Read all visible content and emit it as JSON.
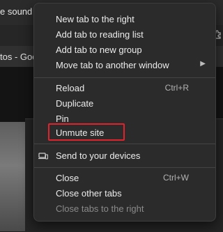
{
  "background": {
    "tab_top_title": "e sound o",
    "tab_top_close": "×",
    "extension_icon": "puzzle-icon",
    "tab_second_title": "tos - Goo"
  },
  "context_menu": {
    "items": [
      {
        "label": "New tab to the right"
      },
      {
        "label": "Add tab to reading list"
      },
      {
        "label": "Add tab to new group"
      },
      {
        "label": "Move tab to another window",
        "has_submenu": true,
        "submenu_arrow": "▶"
      },
      {
        "label": "Reload",
        "shortcut": "Ctrl+R"
      },
      {
        "label": "Duplicate"
      },
      {
        "label": "Pin"
      },
      {
        "label": "Unmute site",
        "highlighted": true
      },
      {
        "label": "Send to your devices",
        "icon": "send-to-devices-icon"
      },
      {
        "label": "Close",
        "shortcut": "Ctrl+W"
      },
      {
        "label": "Close other tabs"
      },
      {
        "label": "Close tabs to the right",
        "disabled": true
      }
    ]
  },
  "colors": {
    "menu_background": "#2b2b2b",
    "highlight_outline": "#e0242e",
    "text": "#ececec",
    "disabled_text": "#8a8a8a"
  }
}
